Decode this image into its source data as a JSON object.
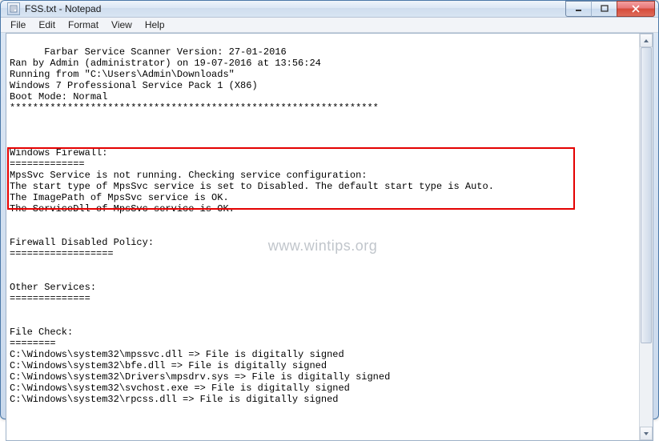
{
  "window": {
    "title": "FSS.txt - Notepad"
  },
  "menu": {
    "file": "File",
    "edit": "Edit",
    "format": "Format",
    "view": "View",
    "help": "Help"
  },
  "content": {
    "lines": "Farbar Service Scanner Version: 27-01-2016\nRan by Admin (administrator) on 19-07-2016 at 13:56:24\nRunning from \"C:\\Users\\Admin\\Downloads\"\nWindows 7 Professional Service Pack 1 (X86)\nBoot Mode: Normal\n****************************************************************\n\n\n\nWindows Firewall:\n=============\nMpsSvc Service is not running. Checking service configuration:\nThe start type of MpsSvc service is set to Disabled. The default start type is Auto.\nThe ImagePath of MpsSvc service is OK.\nThe ServiceDll of MpsSvc service is OK.\n\n\nFirewall Disabled Policy:\n==================\n\n\nOther Services:\n==============\n\n\nFile Check:\n========\nC:\\Windows\\system32\\mpssvc.dll => File is digitally signed\nC:\\Windows\\system32\\bfe.dll => File is digitally signed\nC:\\Windows\\system32\\Drivers\\mpsdrv.sys => File is digitally signed\nC:\\Windows\\system32\\svchost.exe => File is digitally signed\nC:\\Windows\\system32\\rpcss.dll => File is digitally signed"
  },
  "watermark": "www.wintips.org"
}
